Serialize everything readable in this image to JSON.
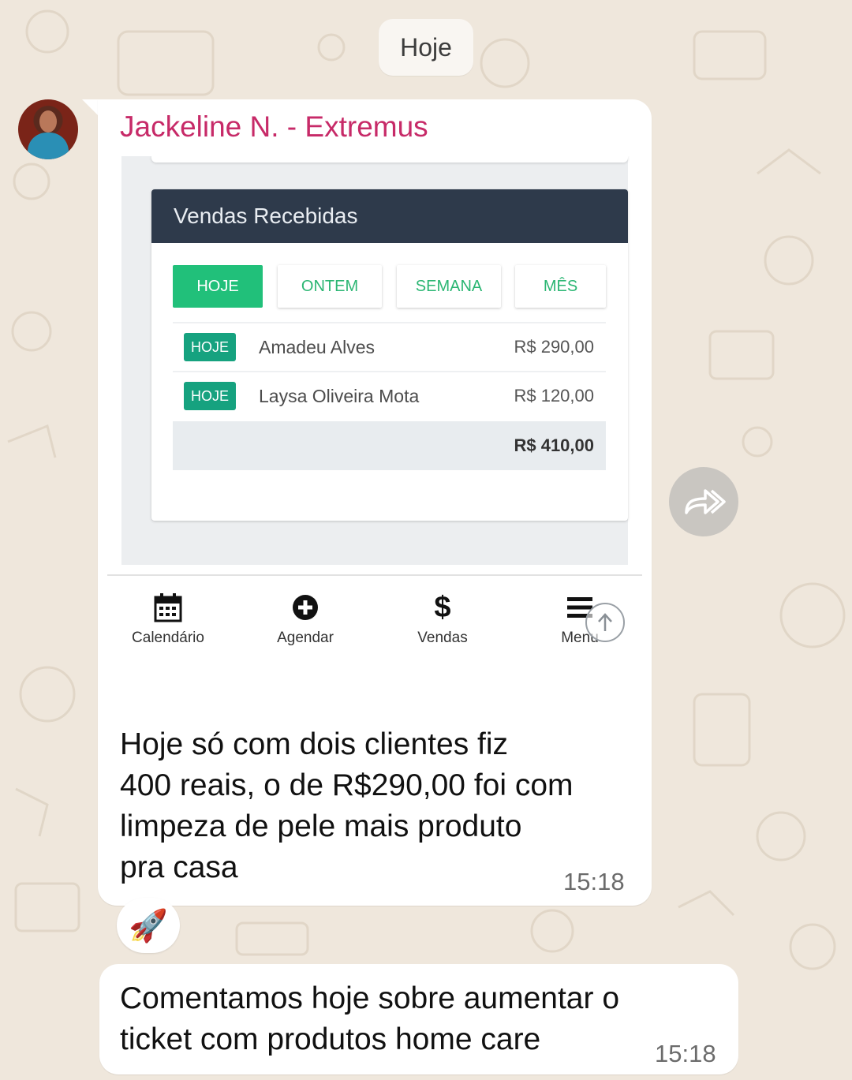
{
  "date_label": "Hoje",
  "sender": "Jackeline N. - Extremus",
  "screenshot": {
    "card_title": "Vendas Recebidas",
    "tabs": [
      "HOJE",
      "ONTEM",
      "SEMANA",
      "MÊS"
    ],
    "active_tab": "HOJE",
    "rows": [
      {
        "badge": "HOJE",
        "name": "Amadeu Alves",
        "value": "R$ 290,00"
      },
      {
        "badge": "HOJE",
        "name": "Laysa Oliveira Mota",
        "value": "R$ 120,00"
      }
    ],
    "total": "R$ 410,00",
    "nav": [
      {
        "label": "Calendário",
        "icon": "calendar-icon"
      },
      {
        "label": "Agendar",
        "icon": "plus-circle-icon"
      },
      {
        "label": "Vendas",
        "icon": "dollar-icon"
      },
      {
        "label": "Menu",
        "icon": "hamburger-menu-icon"
      }
    ]
  },
  "message1": {
    "lines": [
      "Hoje só com dois clientes fiz",
      "400 reais, o de R$290,00 foi com",
      "limpeza de pele mais produto",
      "pra casa"
    ],
    "time": "15:18"
  },
  "reaction": "🚀",
  "message2": {
    "lines": [
      "Comentamos hoje sobre aumentar o",
      "ticket com produtos home care"
    ],
    "time": "15:18"
  },
  "colors": {
    "background": "#efe7dc",
    "sender": "#c72a68",
    "card_header": "#2e3a4b",
    "accent_green": "#21c07a",
    "badge": "#16a27f"
  }
}
